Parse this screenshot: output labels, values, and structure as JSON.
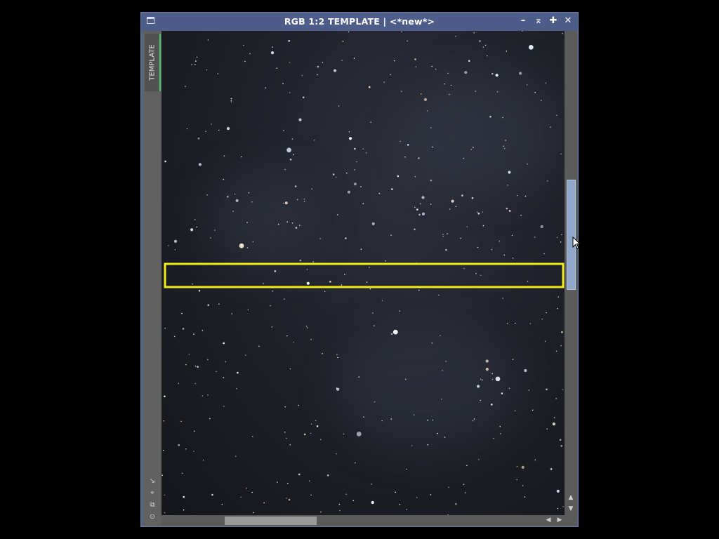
{
  "window": {
    "title": "RGB 1:2 TEMPLATE | <*new*>",
    "buttons": {
      "minimize": "–",
      "shade": "⌅",
      "maximize": "✚",
      "close": "✕"
    }
  },
  "sidebar": {
    "tab_label": "TEMPLATE",
    "tools": [
      "arrow-icon",
      "fit-icon",
      "stack-icon",
      "target-icon"
    ]
  },
  "scrollbars": {
    "up_arrow": "▲",
    "down_arrow": "▼",
    "left_arrow": "◀",
    "right_arrow": "▶"
  },
  "colors": {
    "title_bg": "#4e5c8a",
    "selection": "#f0ec1a",
    "tab_accent": "#3cd06a",
    "scroll_thumb": "#8fa6c8"
  }
}
